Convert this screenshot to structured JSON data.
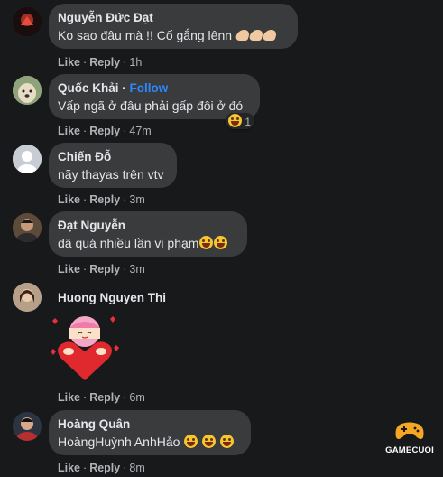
{
  "actions": {
    "like": "Like",
    "reply": "Reply",
    "separator": "·"
  },
  "comments": [
    {
      "name": "Nguyễn Đức Đạt",
      "text": "Ko sao đâu mà !! Cố gắng lênn",
      "time": "1h"
    },
    {
      "name": "Quốc Khải",
      "follow": "Follow",
      "text": "Vấp ngã ở đâu phải gấp đôi ở đó",
      "time": "47m",
      "reaction_count": "1"
    },
    {
      "name": "Chiến Đỗ",
      "text": "nãy thayas trên vtv",
      "time": "3m"
    },
    {
      "name": "Đạt Nguyễn",
      "text": "dã quá nhiều lần vi phạm",
      "time": "3m"
    },
    {
      "name": "Huong Nguyen Thi",
      "text": "",
      "time": "6m"
    },
    {
      "name": "Hoàng Quân",
      "text": "HoàngHuỳnh AnhHảo",
      "time": "8m"
    }
  ],
  "watermark": {
    "text": "GAMECUOI"
  },
  "colors": {
    "background": "#18191a",
    "bubble": "#3a3b3c",
    "follow": "#2d88ff",
    "muted": "#b0b3b8"
  }
}
